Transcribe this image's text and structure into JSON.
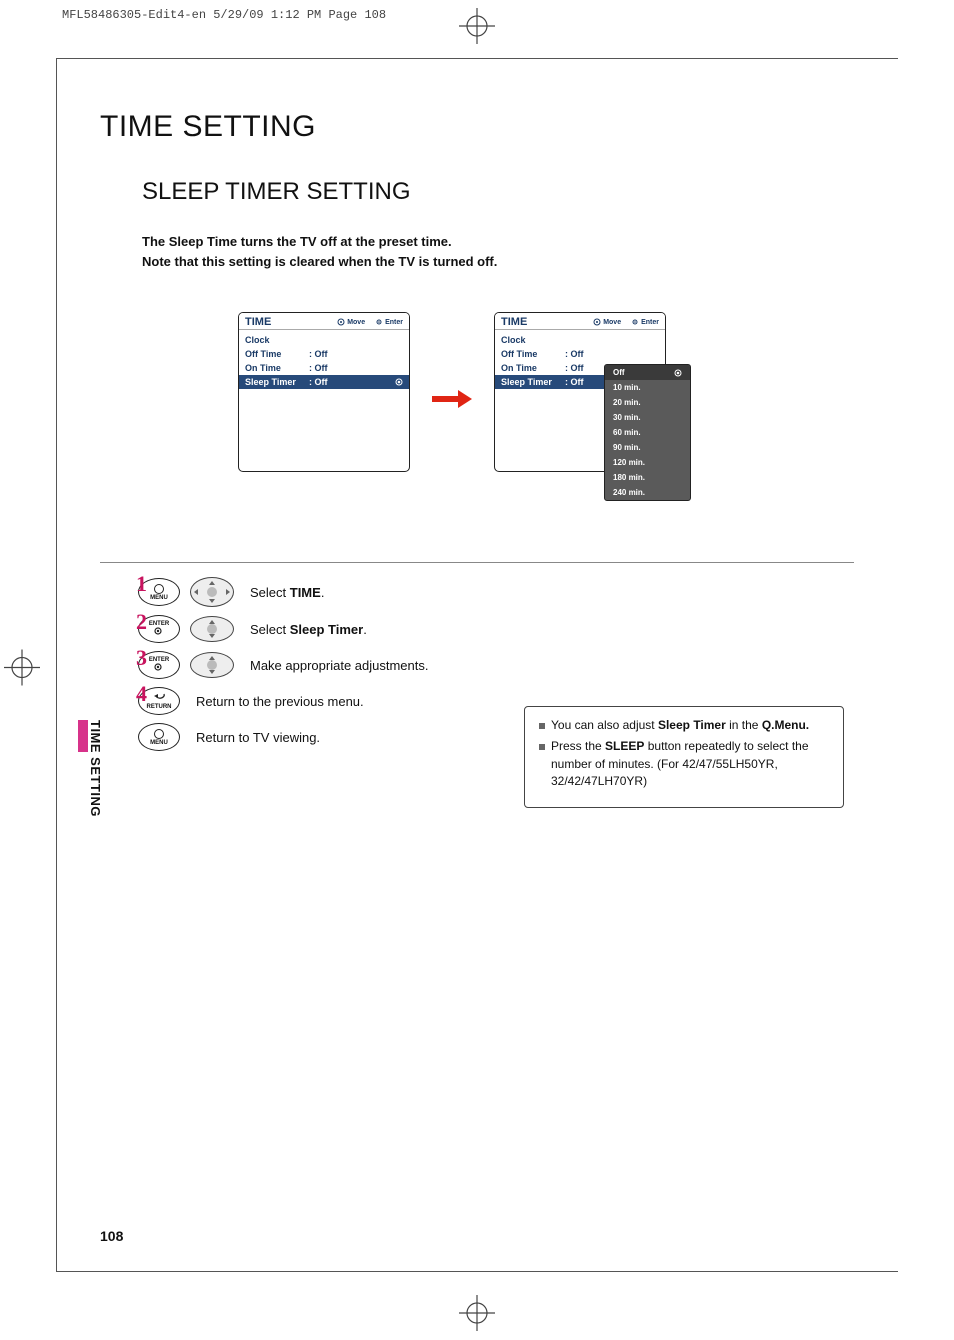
{
  "print_meta": "MFL58486305-Edit4-en  5/29/09  1:12 PM  Page 108",
  "page_number": "108",
  "h1": "TIME SETTING",
  "h2": "SLEEP TIMER SETTING",
  "intro_line1": "The Sleep Time turns the TV off at the preset time.",
  "intro_line2": "Note that this setting is cleared when the TV is turned off.",
  "side_tab": "TIME SETTING",
  "panel_left": {
    "title": "TIME",
    "head_move": "Move",
    "head_enter": "Enter",
    "rows": {
      "clock": {
        "label": "Clock",
        "value": ""
      },
      "off_time": {
        "label": "Off Time",
        "value": ": Off"
      },
      "on_time": {
        "label": "On Time",
        "value": ": Off"
      },
      "sleep_timer": {
        "label": "Sleep Timer",
        "value": ": Off"
      }
    }
  },
  "panel_right": {
    "title": "TIME",
    "head_move": "Move",
    "head_enter": "Enter",
    "rows": {
      "clock": {
        "label": "Clock",
        "value": ""
      },
      "off_time": {
        "label": "Off Time",
        "value": ": Off"
      },
      "on_time": {
        "label": "On Time",
        "value": ": Off"
      },
      "sleep_timer": {
        "label": "Sleep Timer",
        "value": ": Off"
      }
    },
    "dropdown": {
      "items": {
        "opt0": "Off",
        "opt1": "10 min.",
        "opt2": "20 min.",
        "opt3": "30 min.",
        "opt4": "60 min.",
        "opt5": "90 min.",
        "opt6": "120 min.",
        "opt7": "180 min.",
        "opt8": "240 min."
      }
    }
  },
  "steps": {
    "s1": {
      "num": "1",
      "btn": "MENU",
      "text_pre": "Select ",
      "text_bold": "TIME",
      "text_post": "."
    },
    "s2": {
      "num": "2",
      "btn": "ENTER",
      "text_pre": "Select ",
      "text_bold": "Sleep Timer",
      "text_post": "."
    },
    "s3": {
      "num": "3",
      "btn": "ENTER",
      "text": "Make appropriate adjustments."
    },
    "s4": {
      "num": "4",
      "btn": "RETURN",
      "text": "Return to the previous menu."
    },
    "s5": {
      "btn": "MENU",
      "text": "Return to TV viewing."
    }
  },
  "notebox": {
    "li1_pre": "You can also adjust ",
    "li1_bold1": "Sleep Timer",
    "li1_mid": " in the ",
    "li1_bold2": "Q.Menu.",
    "li2_pre": "Press the ",
    "li2_bold": "SLEEP",
    "li2_post": " button repeatedly to select the number of minutes. (For 42/47/55LH50YR, 32/42/47LH70YR)"
  }
}
